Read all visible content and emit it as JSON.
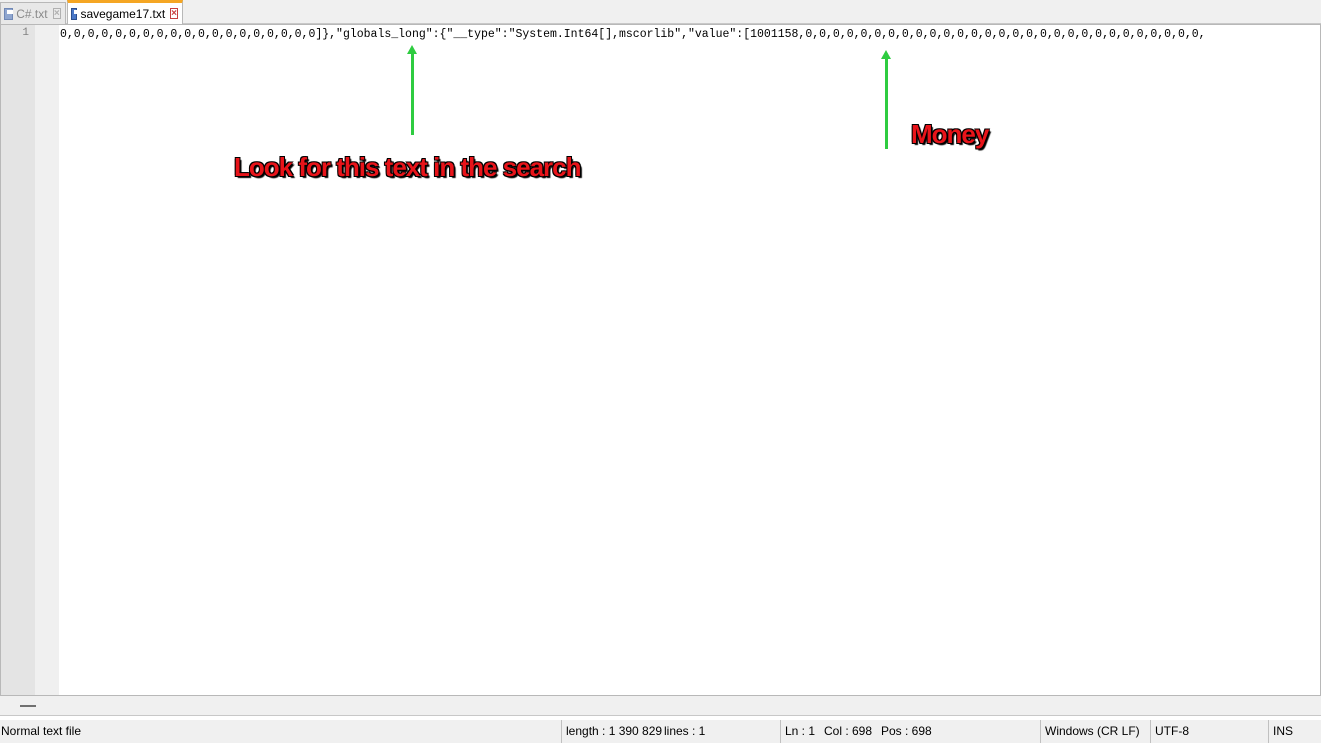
{
  "tabs": [
    {
      "label": "C#.txt",
      "active": false
    },
    {
      "label": "savegame17.txt",
      "active": true
    }
  ],
  "editor": {
    "line_number": "1",
    "line_text": "0,0,0,0,0,0,0,0,0,0,0,0,0,0,0,0,0,0,0]},\"globals_long\":{\"__type\":\"System.Int64[],mscorlib\",\"value\":[1001158,0,0,0,0,0,0,0,0,0,0,0,0,0,0,0,0,0,0,0,0,0,0,0,0,0,0,0,0,0,"
  },
  "annotations": {
    "search_hint": "Look for this text in the search",
    "money_label": "Money",
    "arrow_color": "#2ecc40",
    "text_color": "#e8141a"
  },
  "statusbar": {
    "file_type": "Normal text file",
    "length": "length : 1 390 829",
    "lines": "lines : 1",
    "ln": "Ln : 1",
    "col": "Col : 698",
    "pos": "Pos : 698",
    "eol": "Windows (CR LF)",
    "encoding": "UTF-8",
    "mode": "INS"
  }
}
